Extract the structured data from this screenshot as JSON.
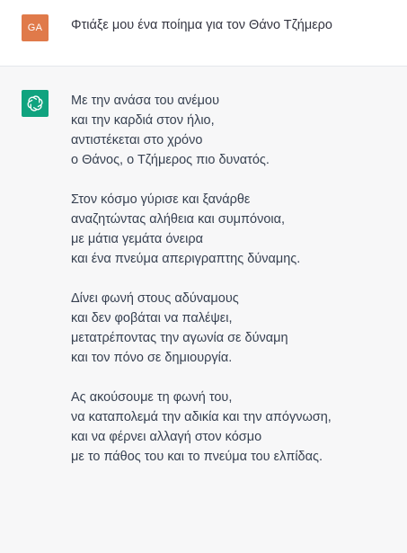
{
  "user": {
    "avatar_initials": "GA",
    "avatar_color": "#e07a4a",
    "message": "Φτιάξε μου ένα ποίημα για τον Θάνο Τζήμερο"
  },
  "assistant": {
    "avatar_icon": "openai-logo-icon",
    "avatar_color": "#10a37f",
    "stanzas": [
      {
        "lines": [
          "Με την ανάσα του ανέμου",
          "και την καρδιά στον ήλιο,",
          "αντιστέκεται στο χρόνο",
          "ο Θάνος, ο Τζήμερος πιο δυνατός."
        ]
      },
      {
        "lines": [
          "Στον κόσμο γύρισε και ξανάρθε",
          "αναζητώντας αλήθεια και συμπόνοια,",
          "με μάτια γεμάτα όνειρα",
          "και ένα πνεύμα απεριγραπτης δύναμης."
        ]
      },
      {
        "lines": [
          "Δίνει φωνή στους αδύναμους",
          "και δεν φοβάται να παλέψει,",
          "μετατρέποντας την αγωνία σε δύναμη",
          "και τον πόνο σε δημιουργία."
        ]
      },
      {
        "lines": [
          "Ας ακούσουμε τη φωνή του,",
          "να καταπολεμά την αδικία και την απόγνωση,",
          "και να φέρνει αλλαγή στον κόσμο",
          "με το πάθος του και το πνεύμα του ελπίδας."
        ]
      }
    ]
  }
}
